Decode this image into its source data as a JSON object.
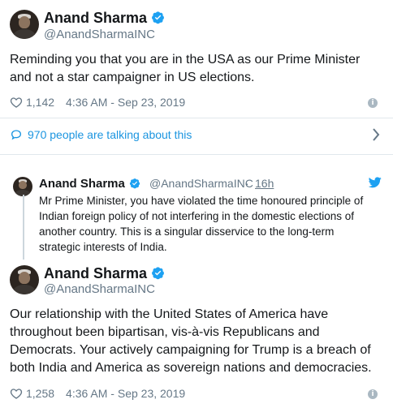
{
  "tweet1": {
    "name": "Anand Sharma",
    "handle": "@AnandSharmaINC",
    "text_line1": "Reminding you that you are in the USA as our Prime Minister",
    "text_line2": "and not a star campaigner in US elections.",
    "likes": "1,142",
    "timestamp": "4:36 AM - Sep 23, 2019",
    "talking": "970 people are talking about this"
  },
  "quoted": {
    "name": "Anand Sharma",
    "handle": "@AnandSharmaINC",
    "separator": "·",
    "time": "16h",
    "lines": [
      "Mr Prime Minister, you have violated the time honoured principle of",
      "Indian foreign policy of not interfering in the domestic elections of",
      "another country. This is a singular disservice to the long-term",
      "strategic interests of India."
    ]
  },
  "tweet2": {
    "name": "Anand Sharma",
    "handle": "@AnandSharmaINC",
    "lines": [
      "Our relationship with the United States of America have",
      "throughout been bipartisan, vis-à-vis Republicans and",
      "Democrats. Your actively campaigning for Trump is a breach of",
      "both India and America as sovereign nations and democracies."
    ],
    "likes": "1,258",
    "timestamp": "4:36 AM - Sep 23, 2019"
  },
  "icons": [
    "verified-badge-icon",
    "heart-icon",
    "info-icon",
    "comment-icon",
    "chevron-right-icon",
    "twitter-bird-icon"
  ],
  "colors": {
    "accent": "#1da1f2",
    "link": "#1b95e0",
    "muted": "#657786",
    "text": "#14171a"
  }
}
